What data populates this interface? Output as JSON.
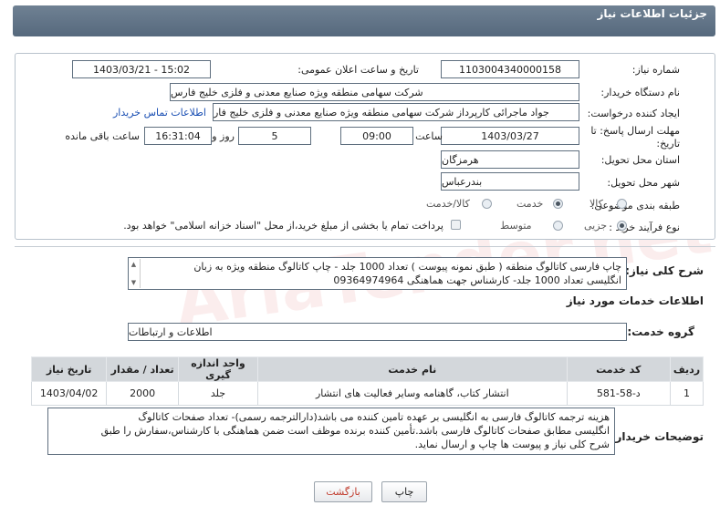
{
  "header": {
    "title": "جزئیات اطلاعات نیاز"
  },
  "fields": {
    "need_number_label": "شماره نیاز:",
    "need_number": "1103004340000158",
    "announce_label": "تاریخ و ساعت اعلان عمومی:",
    "announce_value": "1403/03/21 - 15:02",
    "buyer_org_label": "نام دستگاه خریدار:",
    "buyer_org": "شرکت سهامی منطقه ویژه صنایع معدنی و فلزی خلیج فارس",
    "requester_label": "ایجاد کننده درخواست:",
    "requester": "جواد ماجرائی کارپرداز شرکت سهامی منطقه ویژه صنایع معدنی و فلزی خلیج فار",
    "contact_link": "اطلاعات تماس خریدار",
    "deadline_label_1": "مهلت ارسال پاسخ: تا",
    "deadline_label_2": "تاریخ:",
    "deadline_date": "1403/03/27",
    "time_label": "ساعت",
    "deadline_time": "09:00",
    "days_value": "5",
    "days_label": "روز و",
    "remaining_time": "16:31:04",
    "remaining_label": "ساعت باقی مانده",
    "province_label": "استان محل تحویل:",
    "province": "هرمزگان",
    "city_label": "شهر محل تحویل:",
    "city": "بندرعباس",
    "category_label": "طبقه بندی موضوعی:",
    "category_options": [
      "کالا",
      "خدمت",
      "کالا/خدمت"
    ],
    "category_selected": 1,
    "process_label": "نوع فرآیند خرید :",
    "process_options": [
      "جزیی",
      "متوسط"
    ],
    "process_selected": 0,
    "payment_note": "پرداخت تمام یا بخشی از مبلغ خرید،از محل \"اسناد خزانه اسلامی\" خواهد بود."
  },
  "description": {
    "label": "شرح کلی نیاز:",
    "text_line1": "چاپ فارسی کاتالوگ منطقه ( طبق نمونه پیوست ) تعداد 1000 جلد - چاپ کاتالوگ منطقه ویژه به زبان",
    "text_line2": "انگلیسی تعداد 1000 جلد- کارشناس جهت هماهنگی 09364974964"
  },
  "services": {
    "section_title": "اطلاعات خدمات مورد نیاز",
    "group_label": "گروه خدمت:",
    "group_value": "اطلاعات و ارتباطات",
    "columns": [
      "ردیف",
      "کد خدمت",
      "نام خدمت",
      "واحد اندازه گیری",
      "تعداد / مقدار",
      "تاریخ نیاز"
    ],
    "rows": [
      {
        "row": "1",
        "code": "د-58-581",
        "name": "انتشار کتاب، گاهنامه وسایر فعالیت های انتشار",
        "unit": "جلد",
        "qty": "2000",
        "date": "1403/04/02"
      }
    ]
  },
  "buyer_notes": {
    "label": "توضیحات خریدار:",
    "line1": "هزینه ترجمه کاتالوگ فارسی به انگلیسی بر عهده تامین کننده می باشد(دارالترجمه رسمی)- تعداد صفحات کاتالوگ",
    "line2": "انگلیسی مطابق صفحات کاتالوگ فارسی باشد.تأمین کننده برنده موظف است ضمن هماهنگی با کارشناس،سفارش را طبق",
    "line3": "شرح کلی نیاز و پیوست ها چاپ و ارسال نماید."
  },
  "buttons": {
    "print": "چاپ",
    "back": "بازگشت"
  },
  "colors": {
    "header": "#5f7286",
    "link": "#1a4fb3",
    "back_button_text": "#c0392b"
  }
}
